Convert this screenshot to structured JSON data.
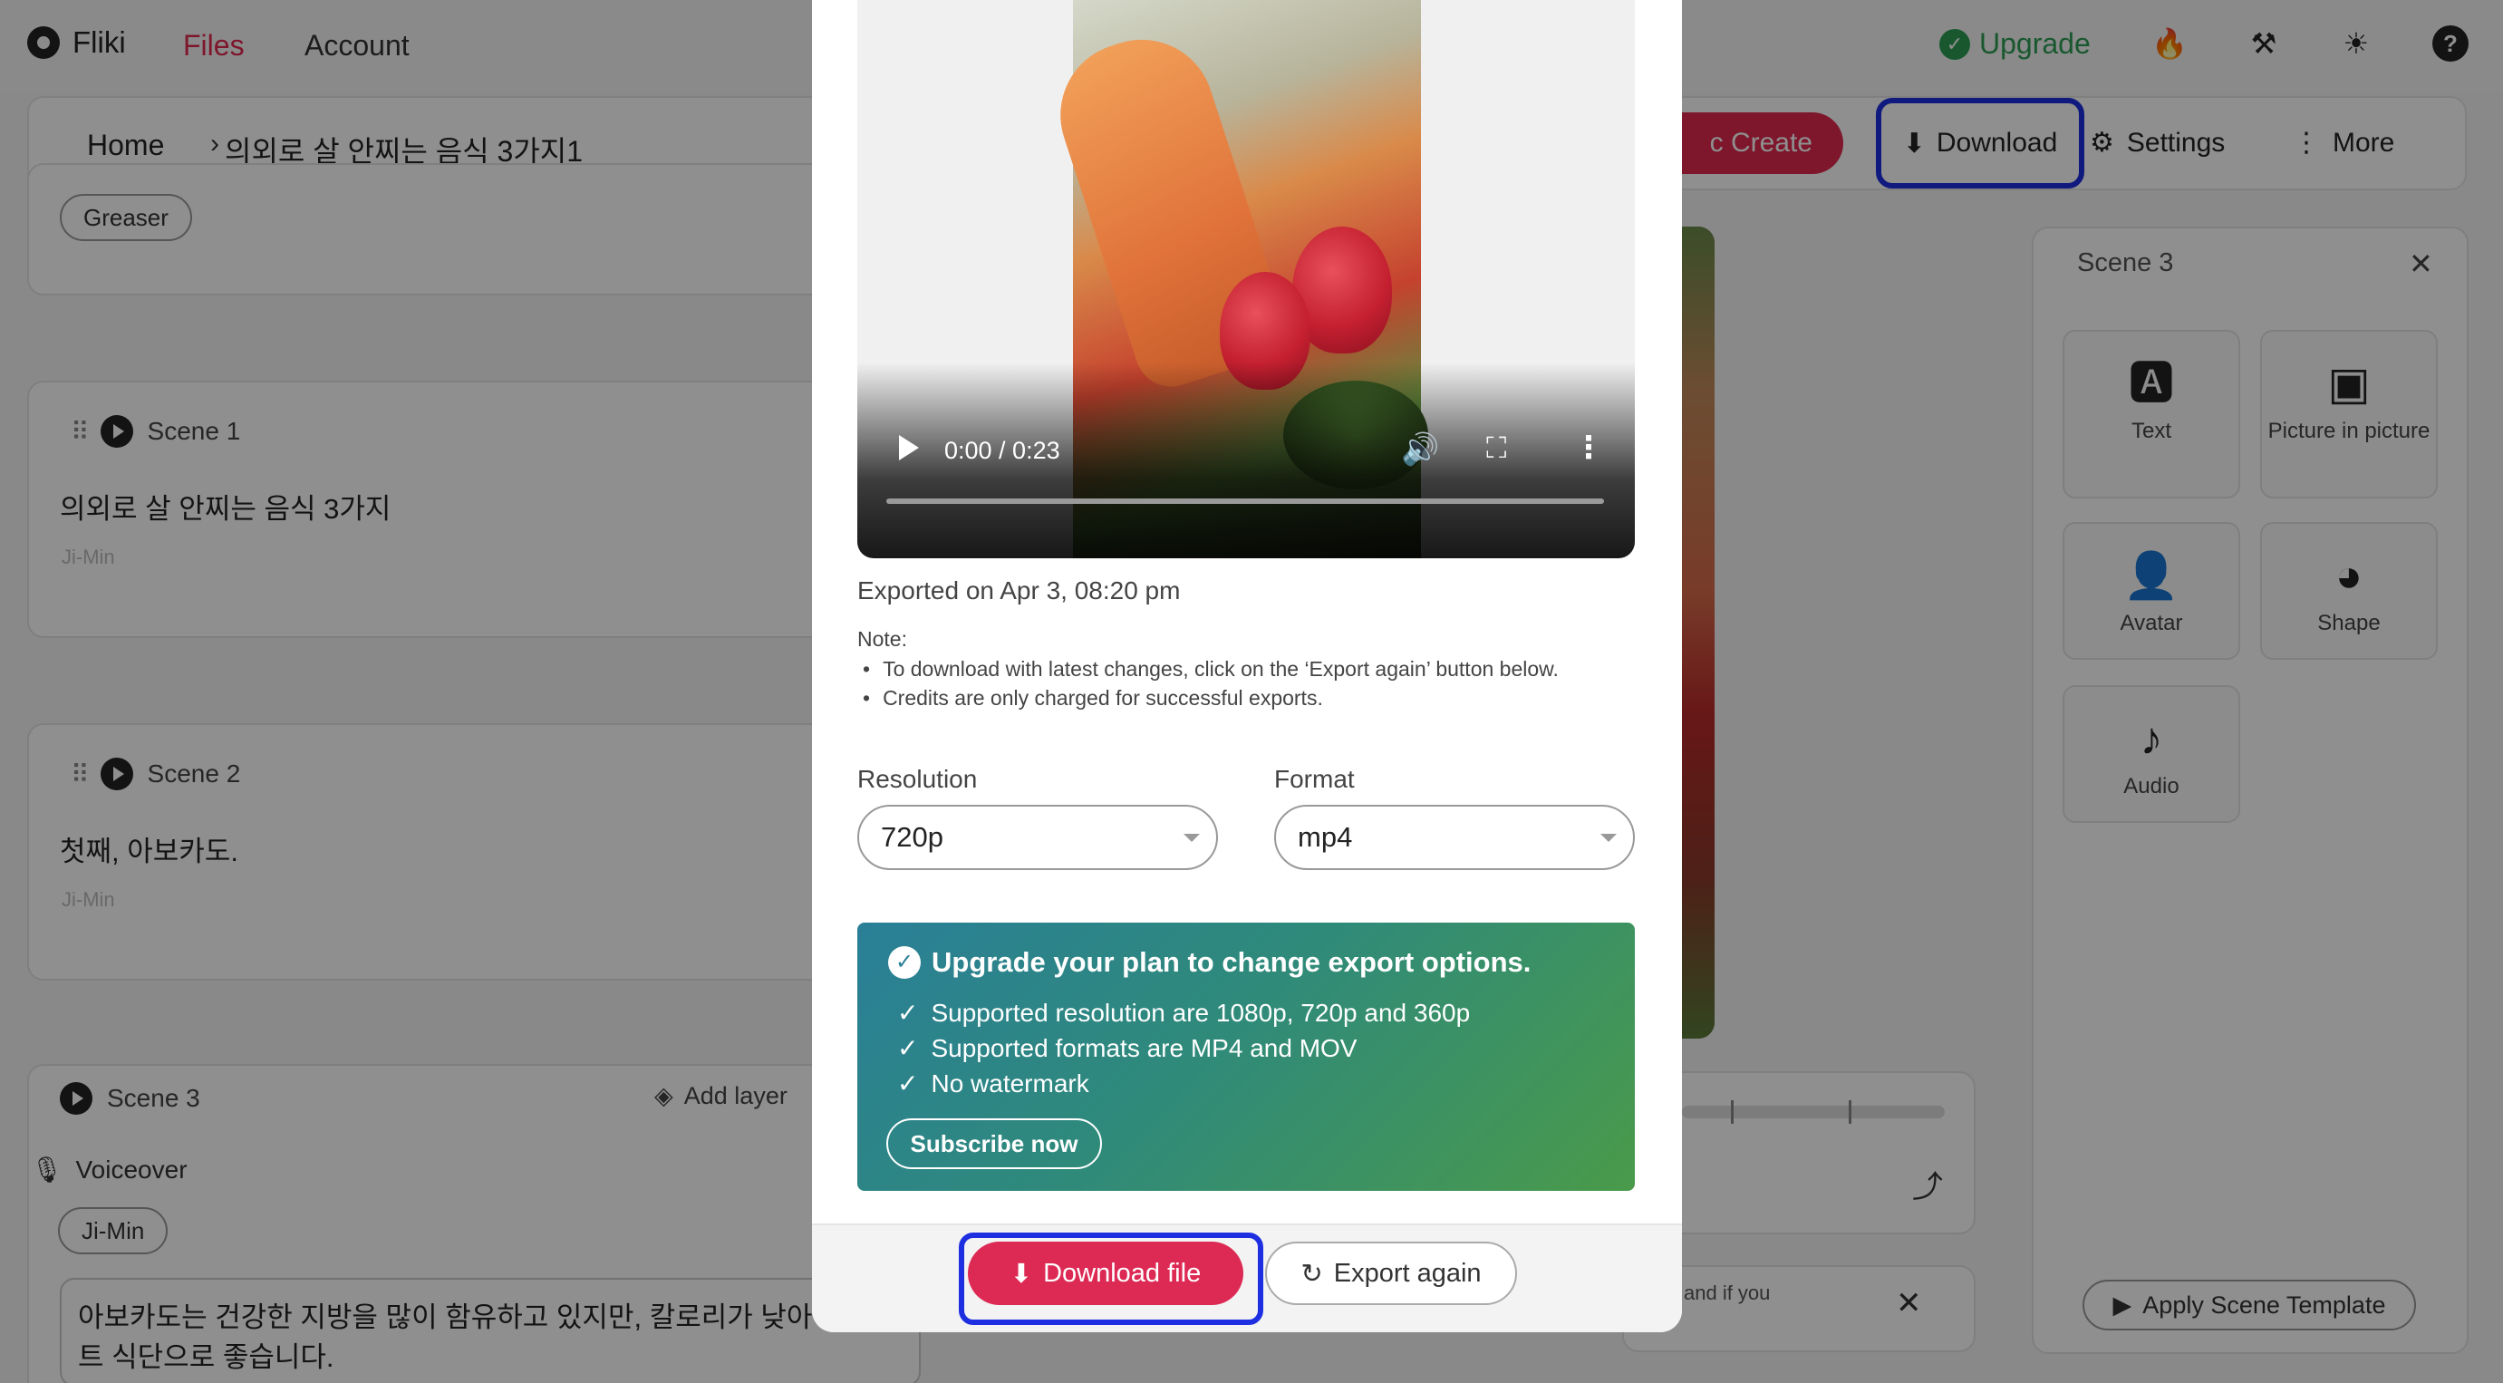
{
  "app": {
    "brand": "Fliki"
  },
  "nav": {
    "files": "Files",
    "account": "Account",
    "upgrade": "Upgrade"
  },
  "breadcrumb": {
    "home": "Home",
    "separator": "›",
    "project": "의외로 살 안찌는 음식 3가지1"
  },
  "toolbar": {
    "magic_create": "c Create",
    "download": "Download",
    "settings": "Settings",
    "more": "More"
  },
  "scenes": {
    "top_chip": "Greaser",
    "scene1": {
      "label": "Scene 1",
      "text": "의외로 살 안찌는 음식 3가지",
      "voice": "Ji-Min"
    },
    "scene2": {
      "label": "Scene 2",
      "text": "첫째, 아보카도.",
      "voice": "Ji-Min"
    },
    "scene3": {
      "label": "Scene 3",
      "add_layer": "Add layer",
      "voiceover": "Voiceover",
      "voice_chip": "Ji-Min",
      "text": "아보카도는 건강한 지방을 많이 함유하고 있지만, 칼로리가 낮아 다이어트 식단으로 좋습니다."
    }
  },
  "notice": {
    "text": "and if you"
  },
  "right_panel": {
    "title": "Scene 3",
    "tiles": {
      "text": "Text",
      "pip": "Picture in picture",
      "avatar": "Avatar",
      "shape": "Shape",
      "audio": "Audio"
    },
    "apply_template": "Apply Scene Template"
  },
  "modal": {
    "video": {
      "time": "0:00 / 0:23"
    },
    "exported": "Exported on Apr 3, 08:20 pm",
    "note_title": "Note:",
    "notes": [
      "To download with latest changes, click on the ‘Export again’ button below.",
      "Credits are only charged for successful exports."
    ],
    "resolution": {
      "label": "Resolution",
      "value": "720p"
    },
    "format": {
      "label": "Format",
      "value": "mp4"
    },
    "promo": {
      "title": "Upgrade your plan to change export options.",
      "items": [
        "Supported resolution are 1080p, 720p and 360p",
        "Supported formats are MP4 and MOV",
        "No watermark"
      ],
      "subscribe": "Subscribe now"
    },
    "download_file": "Download file",
    "export_again": "Export again"
  },
  "colors": {
    "accent": "#e0284f",
    "highlight": "#1d2fe0",
    "upgrade": "#2e9e55"
  }
}
